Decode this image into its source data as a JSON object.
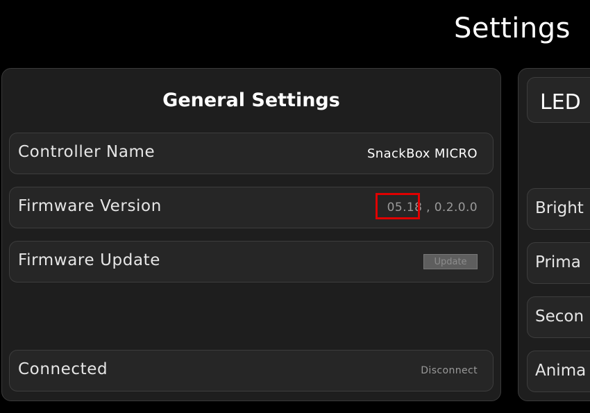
{
  "page": {
    "title": "Settings"
  },
  "general": {
    "title": "General Settings",
    "controller_name": {
      "label": "Controller Name",
      "value": "SnackBox MICRO"
    },
    "firmware_version": {
      "label": "Firmware Version",
      "value": "05.18 , 0.2.0.0"
    },
    "firmware_update": {
      "label": "Firmware Update",
      "button": "Update"
    },
    "connection": {
      "label": "Connected",
      "action": "Disconnect"
    }
  },
  "led": {
    "title": "LED",
    "rows": [
      "Bright",
      "Prima",
      "Secon",
      "Anima"
    ]
  },
  "colors": {
    "background": "#000000",
    "panel": "#1e1e1e",
    "row": "#262626",
    "highlight": "#e00000"
  }
}
